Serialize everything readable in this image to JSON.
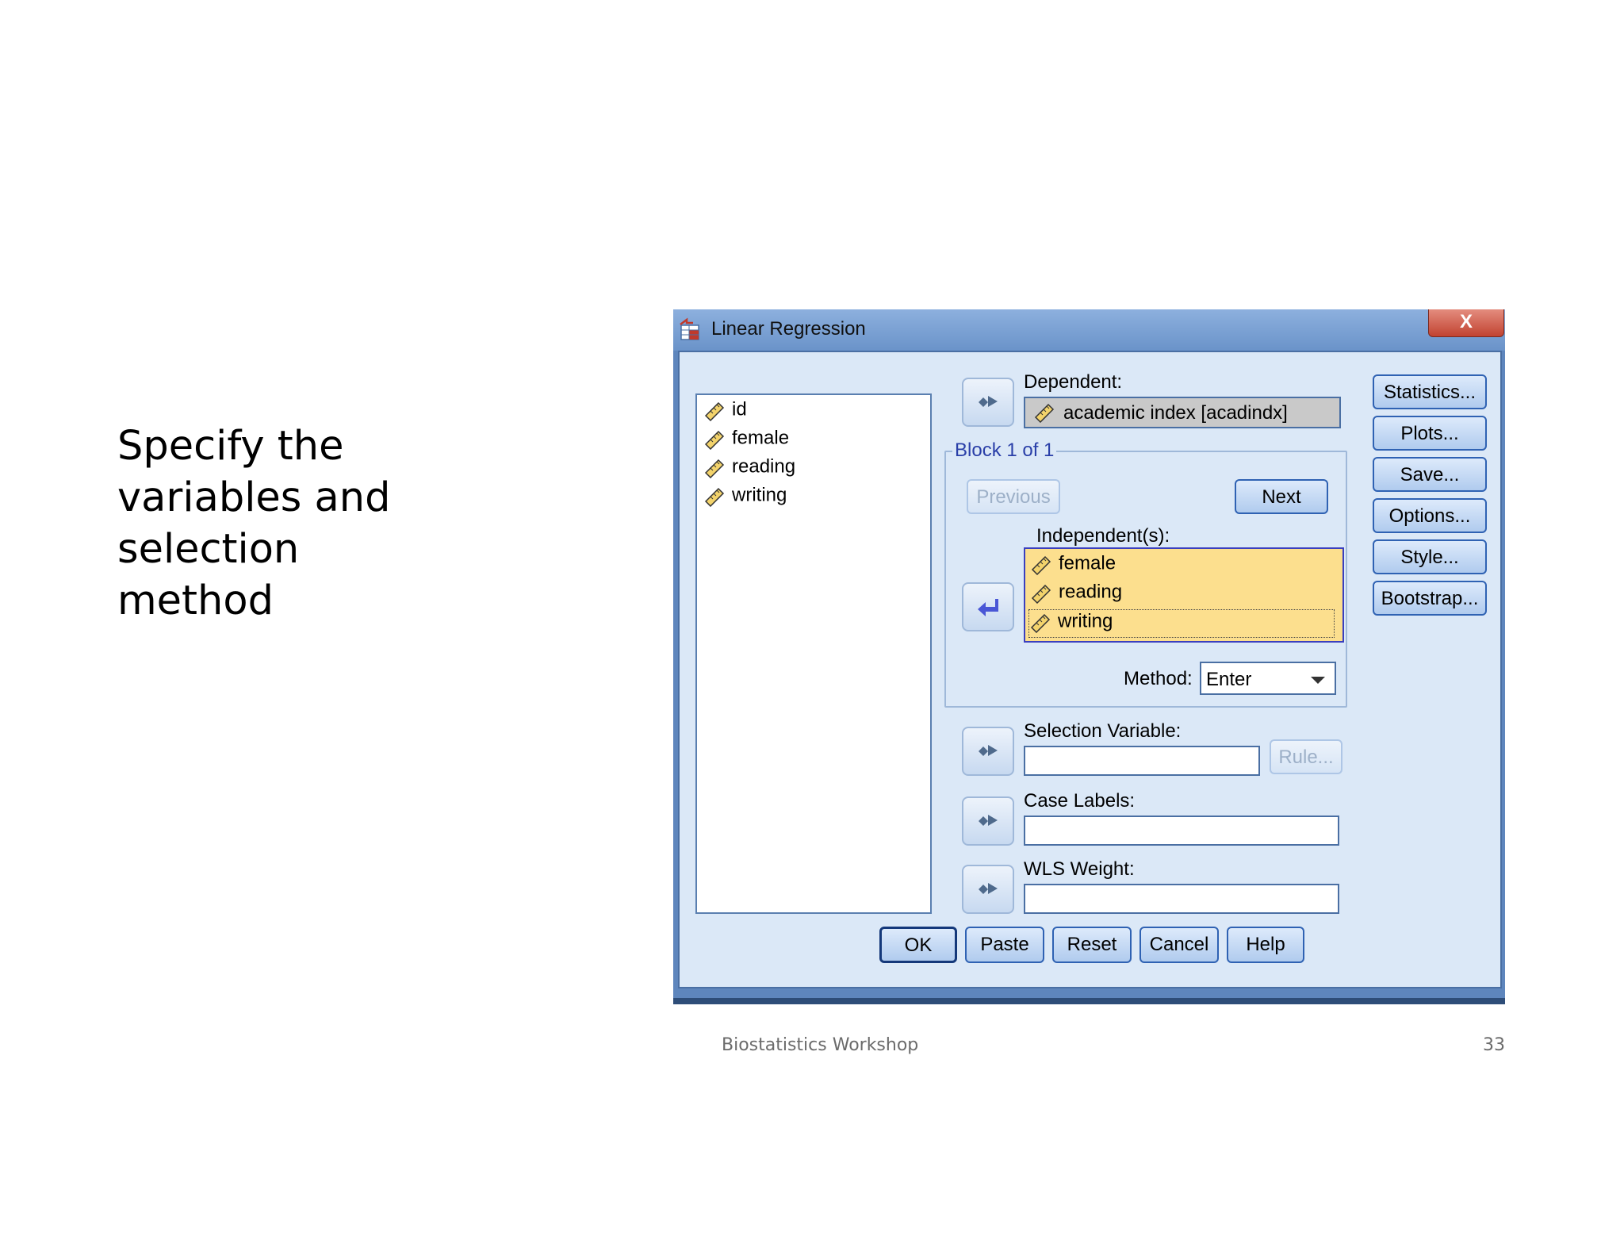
{
  "slide": {
    "text_lines": [
      "Specify the",
      "variables and",
      "selection",
      "method"
    ],
    "footer_left": "Biostatistics Workshop",
    "page_number": "33"
  },
  "dialog": {
    "title": "Linear Regression",
    "close_label": "X",
    "source_variables": [
      "id",
      "female",
      "reading",
      "writing"
    ],
    "dependent_label": "Dependent:",
    "dependent_value": "academic index [acadindx]",
    "block_label": "Block 1 of 1",
    "previous_label": "Previous",
    "next_label": "Next",
    "independents_label": "Independent(s):",
    "independent_variables": [
      "female",
      "reading",
      "writing"
    ],
    "method_label": "Method:",
    "method_value": "Enter",
    "selection_variable_label": "Selection Variable:",
    "rule_label": "Rule...",
    "case_labels_label": "Case Labels:",
    "wls_weight_label": "WLS Weight:",
    "side_buttons": [
      "Statistics...",
      "Plots...",
      "Save...",
      "Options...",
      "Style...",
      "Bootstrap..."
    ],
    "bottom_buttons": [
      "OK",
      "Paste",
      "Reset",
      "Cancel",
      "Help"
    ],
    "colors": {
      "client_bg": "#dbe8f7",
      "independent_highlight": "#fcdf8e",
      "border": "#4a6fa3"
    }
  }
}
